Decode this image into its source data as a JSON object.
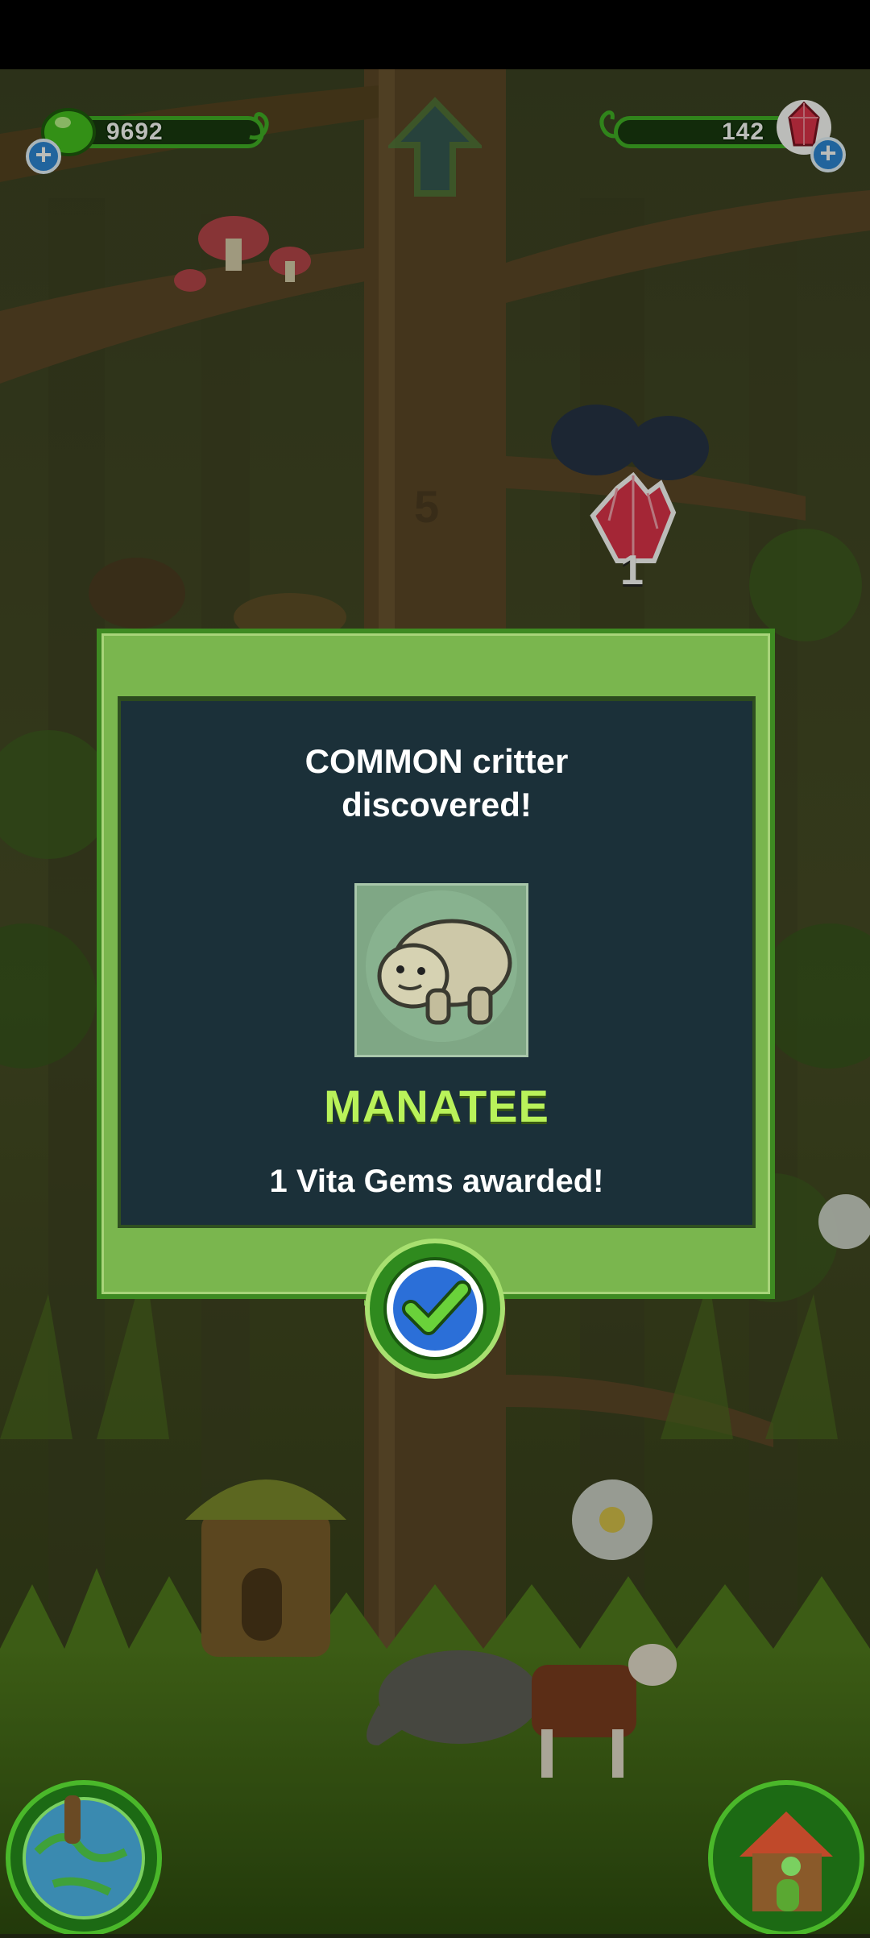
{
  "hud": {
    "energy_value": "9692",
    "gems_value": "142",
    "gem_pickup_count": "1",
    "trunk_marker": "5"
  },
  "dialog": {
    "title_line1": "COMMON critter",
    "title_line2": "discovered!",
    "critter_name": "MANATEE",
    "reward": "1 Vita Gems awarded!"
  },
  "icons": {
    "energy": "green-goo-icon",
    "gems": "red-gem-icon",
    "home": "up-arrow-icon",
    "globe": "globe-icon",
    "house": "treehouse-icon",
    "confirm": "checkmark-icon"
  },
  "colors": {
    "accent_green": "#3fb225",
    "panel_green": "#7ab64e",
    "panel_dark": "#1b3039",
    "name_green": "#b9f25a",
    "gem_red": "#e0304a"
  }
}
